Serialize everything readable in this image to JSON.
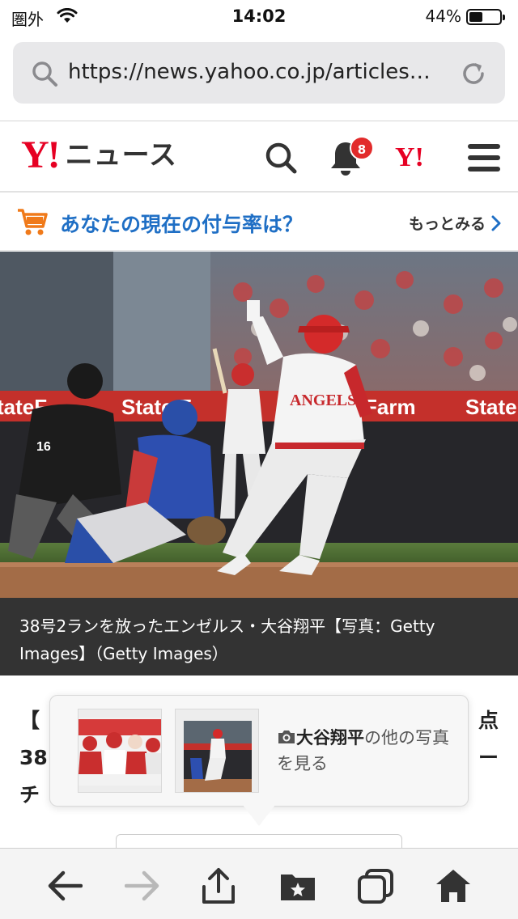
{
  "status_bar": {
    "carrier": "圏外",
    "time": "14:02",
    "battery_percent": "44%",
    "battery_level": 0.44
  },
  "browser": {
    "url": "https://news.yahoo.co.jp/articles…",
    "icons": [
      "search-icon",
      "reload-icon"
    ]
  },
  "header": {
    "logo_mark": "Y!",
    "logo_text": "ニュース",
    "notification_count": "8",
    "yahoo_icon": "Y!",
    "icons": [
      "search-icon",
      "bell-icon",
      "menu-icon"
    ],
    "accent_color": "#e60023"
  },
  "promo": {
    "text": "あなたの現在の付与率は？",
    "more_label": "もっとみる",
    "text_color": "#1f6fc5",
    "cart_color": "#f07a1a"
  },
  "photo": {
    "caption": "38号2ランを放ったエンゼルス・大谷翔平【写真：Getty Images】（Getty Images）",
    "banner_left": "tateF",
    "banner_mid": "State F",
    "banner_right1": "Farm",
    "banner_right2": "State",
    "jersey_team": "ANGELS",
    "umpire_number": "16"
  },
  "article": {
    "line1": "【",
    "line2": "38",
    "line3": "チ",
    "line1_end": "点",
    "line2_end": "ー"
  },
  "popover": {
    "highlight": "大谷翔平",
    "text": "の他の写真を見る",
    "icon": "camera-icon"
  },
  "toolbar": {
    "buttons": [
      "back-icon",
      "forward-icon",
      "share-icon",
      "bookmarks-icon",
      "tabs-icon",
      "home-icon"
    ]
  }
}
